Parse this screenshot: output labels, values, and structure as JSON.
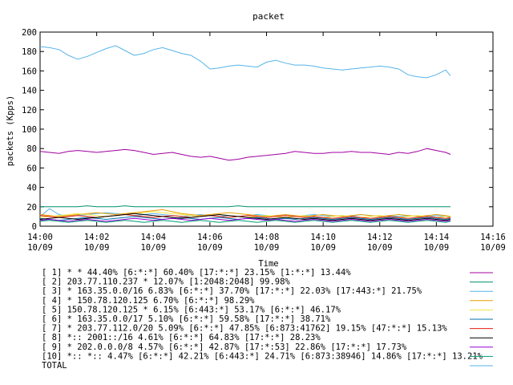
{
  "chart_data": {
    "type": "line",
    "title": "packet",
    "xlabel": "Time",
    "ylabel": "packets (Kpps)",
    "ylim": [
      0,
      200
    ],
    "yticks": [
      0,
      20,
      40,
      60,
      80,
      100,
      120,
      140,
      160,
      180,
      200
    ],
    "grid": false,
    "legend_position": "bottom",
    "x_ticks": [
      {
        "time": "14:00",
        "date": "10/09"
      },
      {
        "time": "14:02",
        "date": "10/09"
      },
      {
        "time": "14:04",
        "date": "10/09"
      },
      {
        "time": "14:06",
        "date": "10/09"
      },
      {
        "time": "14:08",
        "date": "10/09"
      },
      {
        "time": "14:10",
        "date": "10/09"
      },
      {
        "time": "14:12",
        "date": "10/09"
      },
      {
        "time": "14:14",
        "date": "10/09"
      },
      {
        "time": "14:16",
        "date": "10/09"
      }
    ],
    "x_minutes": [
      0.0,
      0.33,
      0.67,
      1.0,
      1.33,
      1.67,
      2.0,
      2.33,
      2.67,
      3.0,
      3.33,
      3.67,
      4.0,
      4.33,
      4.67,
      5.0,
      5.33,
      5.67,
      6.0,
      6.33,
      6.67,
      7.0,
      7.33,
      7.67,
      8.0,
      8.33,
      8.67,
      9.0,
      9.33,
      9.67,
      10.0,
      10.33,
      10.67,
      11.0,
      11.33,
      11.67,
      12.0,
      12.33,
      12.67,
      13.0,
      13.33,
      13.67,
      14.0,
      14.33,
      14.5
    ],
    "series": [
      {
        "name": "[ 1] * * 44.40%  [6:*:*] 60.40% [17:*:*] 23.15% [1:*:*] 13.44%",
        "color": "#a000a0",
        "values": [
          77,
          76,
          75,
          77,
          78,
          77,
          76,
          77,
          78,
          79,
          78,
          76,
          74,
          75,
          76,
          74,
          72,
          71,
          72,
          70,
          68,
          69,
          71,
          72,
          73,
          74,
          75,
          77,
          76,
          75,
          75,
          76,
          76,
          77,
          76,
          76,
          75,
          74,
          76,
          75,
          77,
          80,
          78,
          76,
          74
        ]
      },
      {
        "name": "[ 2] 203.77.110.237 * 12.07%  [1:2048:2048] 99.98%",
        "color": "#009070",
        "values": [
          20,
          20,
          20,
          20,
          20,
          21,
          20,
          20,
          20,
          21,
          20,
          20,
          20,
          20,
          20,
          20,
          20,
          20,
          20,
          20,
          20,
          21,
          20,
          20,
          20,
          20,
          20,
          20,
          20,
          20,
          20,
          20,
          20,
          20,
          20,
          20,
          20,
          20,
          20,
          20,
          20,
          20,
          20,
          20,
          20
        ]
      },
      {
        "name": "[ 3] * 163.35.0.0/16 6.83%  [6:*:*] 37.70% [17:*:*] 22.03% [17:443:*] 21.75%",
        "color": "#56b4e9",
        "values": [
          10,
          18,
          12,
          10,
          11,
          12,
          13,
          14,
          13,
          12,
          11,
          12,
          13,
          12,
          11,
          10,
          11,
          12,
          11,
          10,
          11,
          10,
          11,
          12,
          11,
          10,
          11,
          10,
          11,
          12,
          11,
          10,
          11,
          10,
          12,
          11,
          10,
          11,
          10,
          11,
          10,
          10,
          11,
          10,
          10
        ]
      },
      {
        "name": "[ 4] * 150.78.120.125 6.70%  [6:*:*] 98.29%",
        "color": "#e69f00",
        "values": [
          12,
          11,
          10,
          11,
          12,
          13,
          14,
          13,
          12,
          13,
          14,
          15,
          16,
          17,
          15,
          13,
          12,
          11,
          12,
          13,
          14,
          13,
          12,
          11,
          10,
          11,
          12,
          11,
          10,
          11,
          12,
          11,
          10,
          11,
          12,
          11,
          10,
          11,
          12,
          11,
          10,
          11,
          12,
          11,
          10
        ]
      },
      {
        "name": "[ 5] 150.78.120.125 * 6.15%  [6:443:*] 53.17% [6:*:*] 46.17%",
        "color": "#f0e442",
        "values": [
          9,
          10,
          11,
          12,
          13,
          12,
          11,
          10,
          11,
          12,
          13,
          14,
          15,
          14,
          13,
          12,
          11,
          10,
          11,
          12,
          11,
          10,
          9,
          10,
          11,
          10,
          9,
          10,
          11,
          10,
          9,
          10,
          11,
          10,
          9,
          10,
          11,
          10,
          9,
          10,
          11,
          10,
          9,
          10,
          9
        ]
      },
      {
        "name": "[ 6] * 163.35.0.0/17 5.10%  [6:*:*] 59.58% [17:*:*] 38.71%",
        "color": "#0072b2",
        "values": [
          8,
          7,
          6,
          7,
          8,
          9,
          8,
          7,
          8,
          9,
          10,
          9,
          8,
          7,
          8,
          9,
          8,
          7,
          8,
          9,
          8,
          7,
          8,
          9,
          8,
          7,
          8,
          7,
          8,
          9,
          8,
          7,
          8,
          9,
          8,
          7,
          8,
          9,
          8,
          7,
          8,
          9,
          8,
          7,
          8
        ]
      },
      {
        "name": "[ 7] * 203.77.112.0/20 5.09%  [6:*:*] 47.85% [6:873:41762] 19.15% [47:*:*] 15.13%",
        "color": "#e51e10",
        "values": [
          11,
          10,
          9,
          10,
          11,
          10,
          9,
          10,
          11,
          12,
          11,
          10,
          9,
          10,
          11,
          10,
          9,
          10,
          11,
          10,
          9,
          10,
          11,
          10,
          9,
          10,
          11,
          10,
          9,
          10,
          9,
          8,
          9,
          10,
          9,
          8,
          9,
          10,
          9,
          8,
          9,
          10,
          9,
          8,
          9
        ]
      },
      {
        "name": "[ 8] *:: 2001::/16 4.61%  [6:*:*] 64.83% [17:*:*] 28.23%",
        "color": "#000000",
        "values": [
          7,
          8,
          9,
          8,
          7,
          8,
          9,
          10,
          11,
          12,
          13,
          12,
          11,
          10,
          9,
          8,
          9,
          10,
          11,
          12,
          11,
          10,
          9,
          8,
          7,
          8,
          9,
          8,
          7,
          8,
          7,
          6,
          7,
          8,
          7,
          6,
          7,
          8,
          7,
          6,
          7,
          8,
          7,
          6,
          7
        ]
      },
      {
        "name": "[ 9] * 202.0.0.0/8 4.57%  [6:*:*] 42.87% [17:*:53] 22.86% [17:*:*] 17.73%",
        "color": "#9400d3",
        "values": [
          6,
          7,
          6,
          5,
          6,
          7,
          6,
          5,
          6,
          7,
          8,
          7,
          6,
          7,
          8,
          7,
          6,
          7,
          8,
          7,
          6,
          7,
          8,
          7,
          6,
          7,
          6,
          5,
          6,
          7,
          6,
          5,
          6,
          7,
          6,
          5,
          6,
          7,
          6,
          5,
          6,
          7,
          6,
          5,
          6
        ]
      },
      {
        "name": "[10] *:: *:: 4.47%  [6:*:*] 42.21% [6:443:*] 24.71% [6:873:38946] 14.86% [17:*:*] 13.21%",
        "color": "#009e73",
        "values": [
          5,
          6,
          5,
          4,
          5,
          6,
          5,
          4,
          5,
          6,
          5,
          4,
          5,
          6,
          5,
          4,
          5,
          6,
          5,
          4,
          5,
          6,
          5,
          4,
          5,
          6,
          5,
          4,
          5,
          6,
          5,
          4,
          5,
          6,
          5,
          4,
          5,
          6,
          5,
          4,
          5,
          6,
          5,
          4,
          5
        ]
      },
      {
        "name": "TOTAL",
        "color": "#56b4e9",
        "values": [
          185,
          184,
          182,
          176,
          172,
          175,
          179,
          183,
          186,
          181,
          176,
          178,
          182,
          184,
          181,
          178,
          176,
          170,
          162,
          163,
          165,
          166,
          165,
          164,
          169,
          171,
          168,
          166,
          166,
          165,
          163,
          162,
          161,
          162,
          163,
          164,
          165,
          164,
          162,
          156,
          154,
          153,
          156,
          161,
          155
        ]
      }
    ]
  }
}
